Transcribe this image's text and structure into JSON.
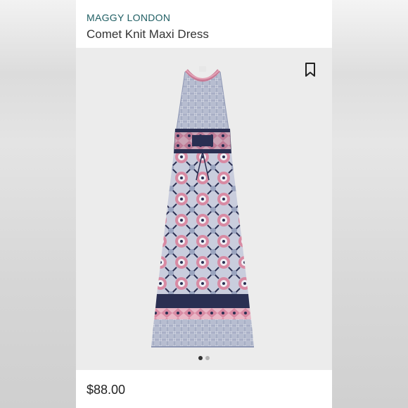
{
  "product": {
    "brand": "MAGGY LONDON",
    "name": "Comet Knit Maxi Dress",
    "price": "$88.00"
  },
  "gallery": {
    "image_count": 2,
    "current_index": 1
  },
  "icons": {
    "save": "bookmark-icon"
  },
  "colors": {
    "brand_text": "#1f5e63",
    "dress_navy": "#2a2f52",
    "dress_pink": "#d88aa3",
    "dress_blue_gray": "#9aa4bf"
  }
}
